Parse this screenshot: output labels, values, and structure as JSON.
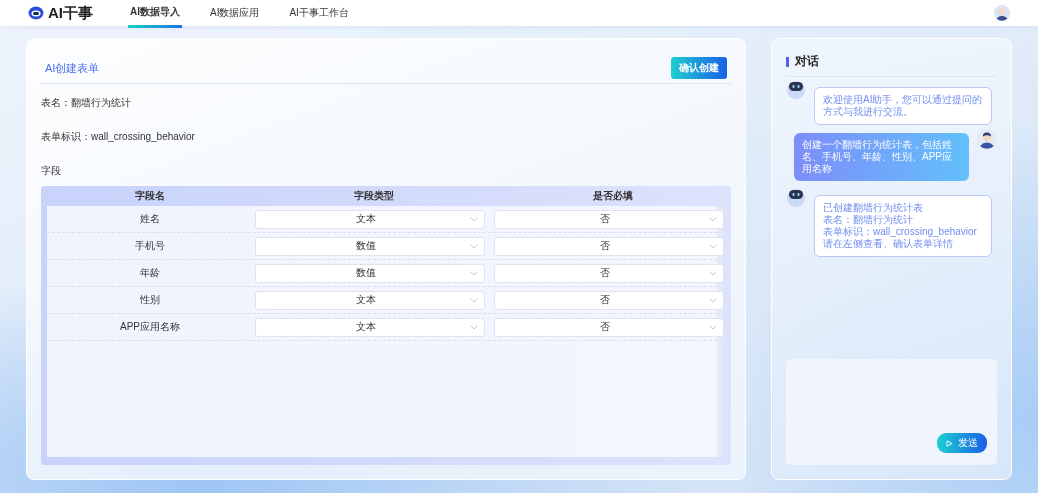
{
  "header": {
    "logo": "AI干事",
    "nav": [
      {
        "label": "AI数据导入",
        "selected": true
      },
      {
        "label": "AI数据应用",
        "selected": false
      },
      {
        "label": "AI干事工作台",
        "selected": false
      }
    ]
  },
  "form": {
    "title": "AI创建表单",
    "confirm_button": "确认创建",
    "table_name": "表名：翻墙行为统计",
    "form_id": "表单标识：wall_crossing_behavior",
    "fields_label": "字段",
    "table": {
      "columns": [
        "字段名",
        "字段类型",
        "是否必填"
      ],
      "rows": [
        {
          "name": "姓名",
          "type": "文本",
          "required": "否"
        },
        {
          "name": "手机号",
          "type": "数值",
          "required": "否"
        },
        {
          "name": "年龄",
          "type": "数值",
          "required": "否"
        },
        {
          "name": "性别",
          "type": "文本",
          "required": "否"
        },
        {
          "name": "APP应用名称",
          "type": "文本",
          "required": "否"
        }
      ]
    }
  },
  "chat": {
    "title": "对话",
    "messages": [
      {
        "kind": "bot",
        "lines": [
          "欢迎使用AI助手，您可以通过提问的方式与我进行交流。"
        ]
      },
      {
        "kind": "user",
        "lines": [
          "创建一个翻墙行为统计表，包括姓名、手机号、年龄、性别、APP应用名称"
        ]
      },
      {
        "kind": "bot",
        "lines": [
          "已创建翻墙行为统计表",
          "表名：翻墙行为统计",
          "表单标识：wall_crossing_behavior",
          "请在左侧查看、确认表单详情"
        ]
      }
    ],
    "send_button": "发送"
  }
}
